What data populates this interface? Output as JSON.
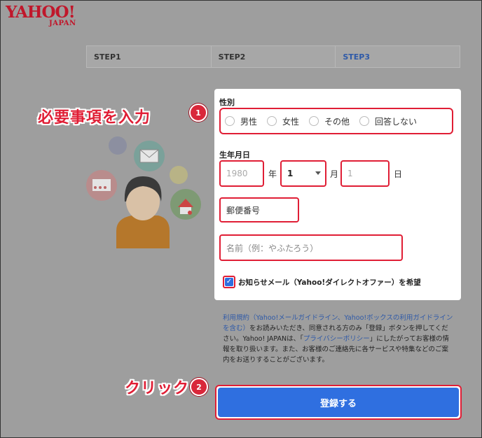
{
  "logo": {
    "main": "YAHOO!",
    "sub": "JAPAN"
  },
  "steps": [
    "STEP1",
    "STEP2",
    "STEP3"
  ],
  "form": {
    "gender_label": "性別",
    "gender_options": [
      "男性",
      "女性",
      "その他",
      "回答しない"
    ],
    "birthday_label": "生年月日",
    "year_placeholder": "1980",
    "year_unit": "年",
    "month_value": "1",
    "month_unit": "月",
    "day_placeholder": "1",
    "day_unit": "日",
    "postal_placeholder": "郵便番号",
    "name_placeholder": "名前（例：やふたろう）",
    "newsletter_label": "お知らせメール（Yahoo!ダイレクトオファー）を希望",
    "newsletter_checked": true
  },
  "terms": {
    "link1": "利用規約（Yahoo!メールガイドライン、Yahoo!ボックスの利用ガイドラインを含む）",
    "text1": "をお読みいただき、同意される方のみ「登録」ボタンを押してください。Yahoo! JAPANは、「",
    "link2": "プライバシーポリシー",
    "text2": "」にしたがってお客様の情報を取り扱います。また、お客様のご連絡先に各サービスや特集などのご案内をお送りすることがございます。"
  },
  "submit_label": "登録する",
  "annotations": {
    "step1_text": "必要事項を入力",
    "step1_num": "1",
    "step2_text": "クリック",
    "step2_num": "2"
  },
  "colors": {
    "accent_red": "#e01e35",
    "button_blue": "#2f6fe0",
    "link_blue": "#2f5aa8"
  }
}
